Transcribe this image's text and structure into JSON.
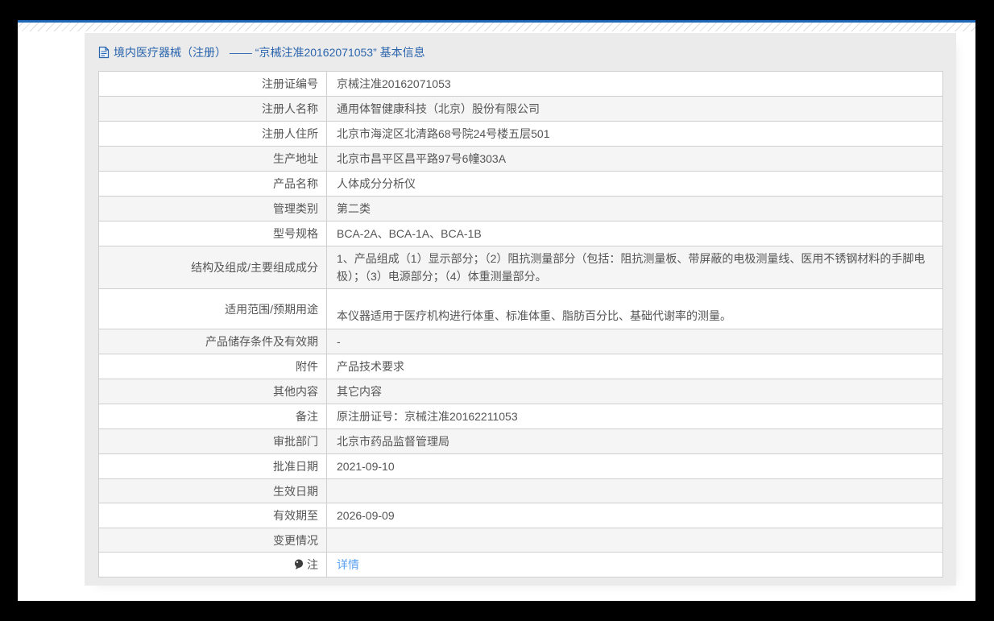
{
  "header": {
    "title": "境内医疗器械（注册） —— “京械注准20162071053” 基本信息",
    "title_icon": "document-icon"
  },
  "colors": {
    "accent_line": "#1e68b8",
    "title_blue": "#2a64ad",
    "link_blue": "#5aa0f2",
    "card_bg": "#ebebeb",
    "row_alt_bg": "#f5f5f5",
    "table_border": "#cfcfcf",
    "text": "#555555"
  },
  "table": {
    "rows": [
      {
        "label": "注册证编号",
        "value": "京械注准20162071053"
      },
      {
        "label": "注册人名称",
        "value": "通用体智健康科技（北京）股份有限公司"
      },
      {
        "label": "注册人住所",
        "value": "北京市海淀区北清路68号院24号楼五层501"
      },
      {
        "label": "生产地址",
        "value": "北京市昌平区昌平路97号6幢303A"
      },
      {
        "label": "产品名称",
        "value": "人体成分分析仪"
      },
      {
        "label": "管理类别",
        "value": "第二类"
      },
      {
        "label": "型号规格",
        "value": "BCA-2A、BCA-1A、BCA-1B"
      },
      {
        "label": "结构及组成/主要组成成分",
        "value": "1、产品组成（1）显示部分；（2）阻抗测量部分（包括：阻抗测量板、带屏蔽的电极测量线、医用不锈钢材料的手脚电极）；（3）电源部分；（4）体重测量部分。"
      },
      {
        "label": "适用范围/预期用途",
        "value": "本仪器适用于医疗机构进行体重、标准体重、脂肪百分比、基础代谢率的测量。"
      },
      {
        "label": "产品储存条件及有效期",
        "value": "-"
      },
      {
        "label": "附件",
        "value": "产品技术要求"
      },
      {
        "label": "其他内容",
        "value": "其它内容"
      },
      {
        "label": "备注",
        "value": "原注册证号：京械注准20162211053"
      },
      {
        "label": "审批部门",
        "value": "北京市药品监督管理局"
      },
      {
        "label": "批准日期",
        "value": "2021-09-10"
      },
      {
        "label": "生效日期",
        "value": ""
      },
      {
        "label": "有效期至",
        "value": "2026-09-09"
      },
      {
        "label": "变更情况",
        "value": ""
      },
      {
        "label": "注",
        "label_icon": "balloon-icon",
        "value": "详情",
        "value_is_link": true
      }
    ]
  }
}
